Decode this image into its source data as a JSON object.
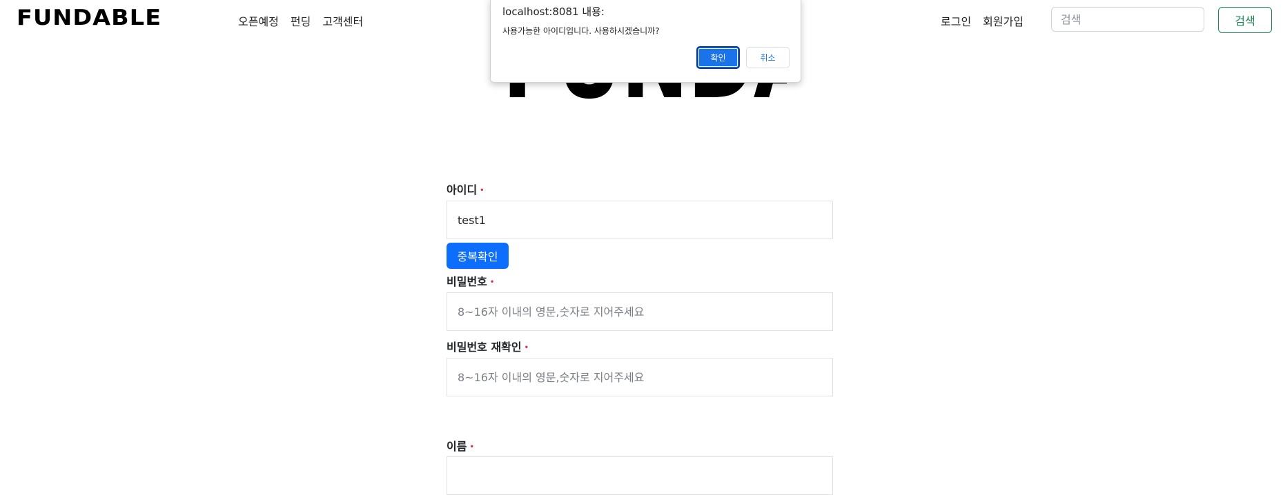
{
  "navbar": {
    "brand": "FUNDABLE",
    "links": [
      "오픈예정",
      "펀딩",
      "고객센터"
    ],
    "login": "로그인",
    "signup": "회원가입",
    "search_placeholder": "검색",
    "search_button": "검색"
  },
  "hero": {
    "logo_text": "FUNDABLE"
  },
  "form": {
    "id_label": "아이디",
    "id_value": "test1",
    "dup_check_button": "중복확인",
    "pw_label": "비밀번호",
    "pw_placeholder": "8~16자 이내의 영문,숫자로 지어주세요",
    "pw_confirm_label": "비밀번호 재확인",
    "pw_confirm_placeholder": "8~16자 이내의 영문,숫자로 지어주세요",
    "name_label": "이름",
    "required_mark": "•"
  },
  "dialog": {
    "title": "localhost:8081 내용:",
    "message": "사용가능한 아이디입니다. 사용하시겠습니까?",
    "ok_button": "확인",
    "cancel_button": "취소"
  },
  "colors": {
    "primary": "#0d6efd",
    "success": "#198754",
    "danger": "#dc3545",
    "dialog_ok": "#1a73e8"
  }
}
